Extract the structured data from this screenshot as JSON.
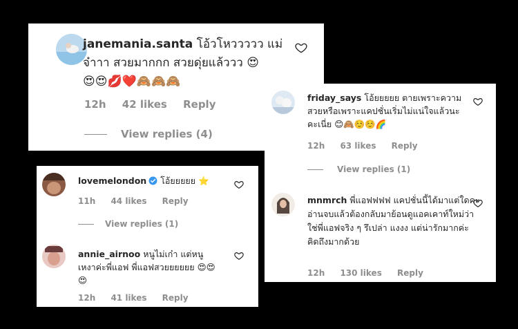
{
  "colors": {
    "background": "#000000",
    "card": "#ffffff",
    "text": "#262626",
    "muted": "#8e8e8e",
    "verified": "#3897f0"
  },
  "comments": [
    {
      "username": "janemania.santa",
      "text": "โอ้วโหววววว แม่จ๋าาา สวยมากกก สวยดุ่ยแล้ววว",
      "emoji_inline": "😍",
      "emoji_line": "😍😍💋❤️🙈🙈🙈",
      "time": "12h",
      "likes": "42 likes",
      "reply": "Reply",
      "view_replies": "View replies (4)"
    },
    {
      "username": "lovemelondon",
      "text": "โอ้ยยยยย",
      "emoji_inline": "⭐",
      "time": "11h",
      "likes": "44 likes",
      "reply": "Reply",
      "view_replies": "View replies (1)"
    },
    {
      "username": "annie_airnoo",
      "text": "หนูไม่เก๋า แต่หนูเหงาค่ะพี่แอฟ พี่แอฟสวยยยยยย",
      "emoji_inline": "😍😍",
      "emoji_line": "😍",
      "time": "12h",
      "likes": "41 likes",
      "reply": "Reply"
    },
    {
      "username": "friday_says",
      "text": "โอ้ยยยยย ตายเพราะความสวยหรือเพราะแคปชั่นเริ่มไม่แน่ใจแล้วนะคะเนี่ย",
      "emoji_inline": "😊🙈☺️☺️🌈",
      "time": "12h",
      "likes": "63 likes",
      "reply": "Reply",
      "view_replies": "View replies (1)"
    },
    {
      "username": "mnmrch",
      "text": "พี่แอฟฟฟฟ แคปชั่นนี้ได้มาแต่ใดคะ อ่านจบแล้วต้องกลับมาย้อนดูแอคเคาท์ใหม่ว่าใช่พี่แอฟจริง ๆ รึเปล่า แงงง แต่น่ารักมากค่ะ คิดถึงมากด้วย",
      "time": "12h",
      "likes": "130 likes",
      "reply": "Reply"
    }
  ]
}
